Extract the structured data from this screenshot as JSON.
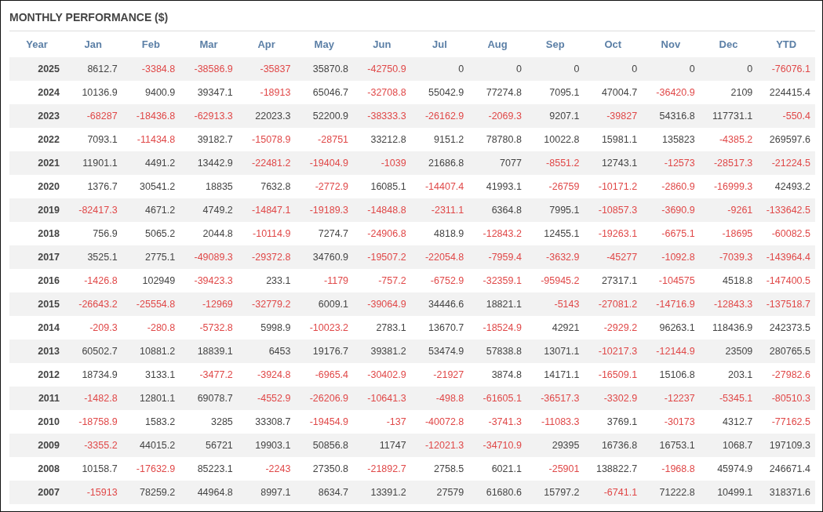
{
  "title": "MONTHLY PERFORMANCE ($)",
  "columns": [
    "Year",
    "Jan",
    "Feb",
    "Mar",
    "Apr",
    "May",
    "Jun",
    "Jul",
    "Aug",
    "Sep",
    "Oct",
    "Nov",
    "Dec",
    "YTD"
  ],
  "rows": [
    [
      "2025",
      "8612.7",
      "-3384.8",
      "-38586.9",
      "-35837",
      "35870.8",
      "-42750.9",
      "0",
      "0",
      "0",
      "0",
      "0",
      "0",
      "-76076.1"
    ],
    [
      "2024",
      "10136.9",
      "9400.9",
      "39347.1",
      "-18913",
      "65046.7",
      "-32708.8",
      "55042.9",
      "77274.8",
      "7095.1",
      "47004.7",
      "-36420.9",
      "2109",
      "224415.4"
    ],
    [
      "2023",
      "-68287",
      "-18436.8",
      "-62913.3",
      "22023.3",
      "52200.9",
      "-38333.3",
      "-26162.9",
      "-2069.3",
      "9207.1",
      "-39827",
      "54316.8",
      "117731.1",
      "-550.4"
    ],
    [
      "2022",
      "7093.1",
      "-11434.8",
      "39182.7",
      "-15078.9",
      "-28751",
      "33212.8",
      "9151.2",
      "78780.8",
      "10022.8",
      "15981.1",
      "135823",
      "-4385.2",
      "269597.6"
    ],
    [
      "2021",
      "11901.1",
      "4491.2",
      "13442.9",
      "-22481.2",
      "-19404.9",
      "-1039",
      "21686.8",
      "7077",
      "-8551.2",
      "12743.1",
      "-12573",
      "-28517.3",
      "-21224.5"
    ],
    [
      "2020",
      "1376.7",
      "30541.2",
      "18835",
      "7632.8",
      "-2772.9",
      "16085.1",
      "-14407.4",
      "41993.1",
      "-26759",
      "-10171.2",
      "-2860.9",
      "-16999.3",
      "42493.2"
    ],
    [
      "2019",
      "-82417.3",
      "4671.2",
      "4749.2",
      "-14847.1",
      "-19189.3",
      "-14848.8",
      "-2311.1",
      "6364.8",
      "7995.1",
      "-10857.3",
      "-3690.9",
      "-9261",
      "-133642.5"
    ],
    [
      "2018",
      "756.9",
      "5065.2",
      "2044.8",
      "-10114.9",
      "7274.7",
      "-24906.8",
      "4818.9",
      "-12843.2",
      "12455.1",
      "-19263.1",
      "-6675.1",
      "-18695",
      "-60082.5"
    ],
    [
      "2017",
      "3525.1",
      "2775.1",
      "-49089.3",
      "-29372.8",
      "34760.9",
      "-19507.2",
      "-22054.8",
      "-7959.4",
      "-3632.9",
      "-45277",
      "-1092.8",
      "-7039.3",
      "-143964.4"
    ],
    [
      "2016",
      "-1426.8",
      "102949",
      "-39423.3",
      "233.1",
      "-1179",
      "-757.2",
      "-6752.9",
      "-32359.1",
      "-95945.2",
      "27317.1",
      "-104575",
      "4518.8",
      "-147400.5"
    ],
    [
      "2015",
      "-26643.2",
      "-25554.8",
      "-12969",
      "-32779.2",
      "6009.1",
      "-39064.9",
      "34446.6",
      "18821.1",
      "-5143",
      "-27081.2",
      "-14716.9",
      "-12843.3",
      "-137518.7"
    ],
    [
      "2014",
      "-209.3",
      "-280.8",
      "-5732.8",
      "5998.9",
      "-10023.2",
      "2783.1",
      "13670.7",
      "-18524.9",
      "42921",
      "-2929.2",
      "96263.1",
      "118436.9",
      "242373.5"
    ],
    [
      "2013",
      "60502.7",
      "10881.2",
      "18839.1",
      "6453",
      "19176.7",
      "39381.2",
      "53474.9",
      "57838.8",
      "13071.1",
      "-10217.3",
      "-12144.9",
      "23509",
      "280765.5"
    ],
    [
      "2012",
      "18734.9",
      "3133.1",
      "-3477.2",
      "-3924.8",
      "-6965.4",
      "-30402.9",
      "-21927",
      "3874.8",
      "14171.1",
      "-16509.1",
      "15106.8",
      "203.1",
      "-27982.6"
    ],
    [
      "2011",
      "-1482.8",
      "12801.1",
      "69078.7",
      "-4552.9",
      "-26206.9",
      "-10641.3",
      "-498.8",
      "-61605.1",
      "-36517.3",
      "-3302.9",
      "-12237",
      "-5345.1",
      "-80510.3"
    ],
    [
      "2010",
      "-18758.9",
      "1583.2",
      "3285",
      "33308.7",
      "-19454.9",
      "-137",
      "-40072.8",
      "-3741.3",
      "-11083.3",
      "3769.1",
      "-30173",
      "4312.7",
      "-77162.5"
    ],
    [
      "2009",
      "-3355.2",
      "44015.2",
      "56721",
      "19903.1",
      "50856.8",
      "11747",
      "-12021.3",
      "-34710.9",
      "29395",
      "16736.8",
      "16753.1",
      "1068.7",
      "197109.3"
    ],
    [
      "2008",
      "10158.7",
      "-17632.9",
      "85223.1",
      "-2243",
      "27350.8",
      "-21892.7",
      "2758.5",
      "6021.1",
      "-25901",
      "138822.7",
      "-1968.8",
      "45974.9",
      "246671.4"
    ],
    [
      "2007",
      "-15913",
      "78259.2",
      "44964.8",
      "8997.1",
      "8634.7",
      "13391.2",
      "27579",
      "61680.6",
      "15797.2",
      "-6741.1",
      "71222.8",
      "10499.1",
      "318371.6"
    ]
  ]
}
